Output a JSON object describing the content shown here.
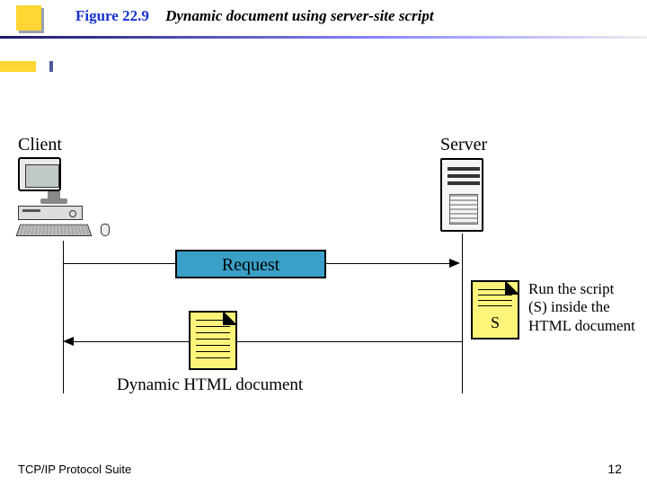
{
  "header": {
    "figure_number": "Figure 22.9",
    "caption": "Dynamic document using server-site script"
  },
  "labels": {
    "client": "Client",
    "server": "Server",
    "request": "Request",
    "script_marker": "S",
    "run_script": "Run the script (S) inside the HTML document",
    "dynamic_doc": "Dynamic HTML document"
  },
  "footer": {
    "source": "TCP/IP Protocol Suite",
    "page": "12"
  }
}
